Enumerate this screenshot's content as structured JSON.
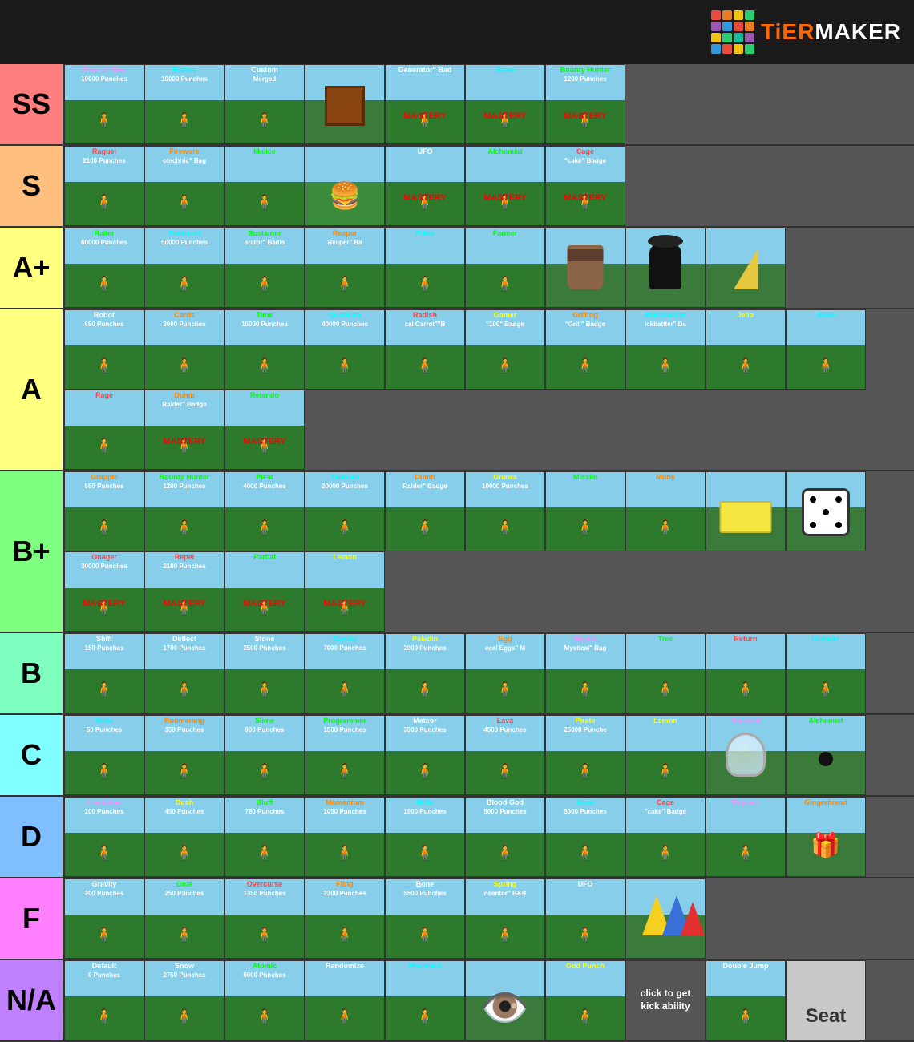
{
  "logo": {
    "text_part1": "TiER",
    "text_part2": "MAKER"
  },
  "tiers": [
    {
      "id": "ss",
      "label": "SS",
      "color": "#ff7f7f",
      "items": [
        {
          "name": "Giver of Sou",
          "sub": "10000 Punches",
          "name_color": "#ff88ff",
          "sub_color": "white",
          "type": "scene"
        },
        {
          "name": "Badius",
          "sub": "10000 Punches",
          "name_color": "#00ffff",
          "sub_color": "white",
          "type": "scene"
        },
        {
          "name": "Custom",
          "sub": "Merged",
          "name_color": "white",
          "sub_color": "white",
          "type": "scene"
        },
        {
          "name": "",
          "sub": "",
          "type": "brown_box"
        },
        {
          "name": "Generator\" Bad",
          "sub": "",
          "name_color": "white",
          "mastery": true,
          "type": "scene"
        },
        {
          "name": "Arow",
          "sub": "",
          "name_color": "#00ffff",
          "mastery": true,
          "type": "scene"
        },
        {
          "name": "Bounty Hunter",
          "sub": "1200 Punches",
          "name_color": "#00ff00",
          "sub_color": "white",
          "mastery": true,
          "type": "scene"
        }
      ]
    },
    {
      "id": "s",
      "label": "S",
      "color": "#ffbf7f",
      "items": [
        {
          "name": "Raguel",
          "sub": "2100 Punches",
          "name_color": "#ff4444",
          "sub_color": "white",
          "type": "scene"
        },
        {
          "name": "Firework",
          "sub": "otechnic\" Bag",
          "name_color": "#ff8800",
          "sub_color": "white",
          "type": "scene"
        },
        {
          "name": "Malice",
          "sub": "",
          "name_color": "#00ff00",
          "sub_color": "white",
          "type": "scene"
        },
        {
          "name": "",
          "sub": "",
          "type": "burger"
        },
        {
          "name": "UFO",
          "sub": "",
          "name_color": "white",
          "mastery": true,
          "type": "scene"
        },
        {
          "name": "Alchemist",
          "sub": "",
          "name_color": "#00ff00",
          "mastery": true,
          "type": "scene"
        },
        {
          "name": "Cage",
          "sub": "\"cake\" Badge",
          "name_color": "#ff4444",
          "mastery": true,
          "type": "scene"
        }
      ]
    },
    {
      "id": "ap",
      "label": "A+",
      "color": "#ffff7f",
      "items": [
        {
          "name": "Railer",
          "sub": "60000 Punches",
          "name_color": "#00ff00",
          "sub_color": "white",
          "type": "scene"
        },
        {
          "name": "Starburst",
          "sub": "50000 Punches",
          "name_color": "#00ffff",
          "sub_color": "white",
          "type": "scene"
        },
        {
          "name": "Sustainer",
          "sub": "erator\" Badis",
          "name_color": "#00ff00",
          "sub_color": "white",
          "type": "scene"
        },
        {
          "name": "Reaper",
          "sub": "Reaper\" Ba",
          "name_color": "#ff8800",
          "sub_color": "white",
          "type": "scene"
        },
        {
          "name": "Pulse",
          "sub": "",
          "name_color": "#00ffff",
          "sub_color": "white",
          "type": "scene"
        },
        {
          "name": "Farmer",
          "sub": "",
          "name_color": "#00ff00",
          "sub_color": "white",
          "type": "scene"
        },
        {
          "name": "",
          "sub": "",
          "type": "coffee"
        },
        {
          "name": "",
          "sub": "",
          "type": "cylinder"
        },
        {
          "name": "",
          "sub": "",
          "type": "wedge"
        }
      ]
    },
    {
      "id": "a",
      "label": "A",
      "color": "#ffff7f",
      "items": [
        {
          "name": "Robot",
          "sub": "650 Punches",
          "name_color": "white",
          "sub_color": "white",
          "type": "scene"
        },
        {
          "name": "Cards",
          "sub": "3000 Punches",
          "name_color": "#ff8800",
          "sub_color": "white",
          "type": "scene"
        },
        {
          "name": "Time",
          "sub": "15000 Punches",
          "name_color": "#00ff00",
          "sub_color": "white",
          "type": "scene"
        },
        {
          "name": "Quantum",
          "sub": "40000 Punches",
          "name_color": "#00ffff",
          "sub_color": "white",
          "type": "scene"
        },
        {
          "name": "Radish",
          "sub": "cal Carrot\"\"B",
          "name_color": "#ff4444",
          "sub_color": "white",
          "type": "scene"
        },
        {
          "name": "Gamer",
          "sub": "\"100\" Badge",
          "name_color": "#ffff00",
          "sub_color": "white",
          "type": "scene"
        },
        {
          "name": "Grilling",
          "sub": "\"Grill\" Badge",
          "name_color": "#ff8800",
          "sub_color": "white",
          "type": "scene"
        },
        {
          "name": "Brickbattler",
          "sub": "ickbattler\" Da",
          "name_color": "#00ffff",
          "sub_color": "white",
          "type": "scene"
        },
        {
          "name": "Jello",
          "sub": "",
          "name_color": "#ffff00",
          "sub_color": "white",
          "type": "scene"
        },
        {
          "name": "Arow",
          "sub": "",
          "name_color": "#00ffff",
          "sub_color": "white",
          "type": "scene"
        },
        {
          "name": "Rage",
          "sub": "",
          "name_color": "#ff4444",
          "sub_color": "white",
          "type": "scene"
        },
        {
          "name": "Dumb",
          "sub": "Raider\" Badge",
          "name_color": "#ff8800",
          "sub_color": "white",
          "mastery": true,
          "type": "scene"
        },
        {
          "name": "Retendo",
          "sub": "",
          "name_color": "#00ff00",
          "sub_color": "white",
          "mastery": true,
          "type": "scene"
        }
      ]
    },
    {
      "id": "bp",
      "label": "B+",
      "color": "#7fff7f",
      "items": [
        {
          "name": "Grapple",
          "sub": "550 Punches",
          "name_color": "#ff8800",
          "sub_color": "white",
          "type": "scene"
        },
        {
          "name": "Bounty Hunter",
          "sub": "1200 Punches",
          "name_color": "#00ff00",
          "sub_color": "white",
          "type": "scene"
        },
        {
          "name": "Pleat",
          "sub": "4000 Punches",
          "name_color": "#00ff00",
          "sub_color": "white",
          "type": "scene"
        },
        {
          "name": "Tantrum",
          "sub": "20000 Punches",
          "name_color": "#00ffff",
          "sub_color": "white",
          "type": "scene"
        },
        {
          "name": "Dumb",
          "sub": "Raider\" Badge",
          "name_color": "#ff8800",
          "sub_color": "white",
          "type": "scene"
        },
        {
          "name": "Gnawa",
          "sub": "10000 Punches",
          "name_color": "#ffff00",
          "sub_color": "white",
          "type": "scene"
        },
        {
          "name": "Missile",
          "sub": "",
          "name_color": "#00ff00",
          "sub_color": "white",
          "type": "scene"
        },
        {
          "name": "Monk",
          "sub": "",
          "name_color": "#ff8800",
          "sub_color": "white",
          "type": "scene"
        },
        {
          "name": "",
          "sub": "",
          "type": "butter"
        },
        {
          "name": "",
          "sub": "",
          "type": "die"
        },
        {
          "name": "Onager",
          "sub": "30000 Punches",
          "name_color": "#ff4444",
          "mastery": true,
          "type": "scene"
        },
        {
          "name": "Repel",
          "sub": "2100 Punches",
          "name_color": "#ff4444",
          "mastery": true,
          "type": "scene"
        },
        {
          "name": "Partial",
          "sub": "",
          "name_color": "#00ff00",
          "mastery": true,
          "type": "scene"
        },
        {
          "name": "Lemon",
          "sub": "",
          "name_color": "#ffff00",
          "mastery": true,
          "type": "scene"
        }
      ]
    },
    {
      "id": "b",
      "label": "B",
      "color": "#7fffbf",
      "items": [
        {
          "name": "Shift",
          "sub": "150 Punches",
          "name_color": "white",
          "sub_color": "white",
          "type": "scene"
        },
        {
          "name": "Deflect",
          "sub": "1700 Punches",
          "name_color": "white",
          "sub_color": "white",
          "type": "scene"
        },
        {
          "name": "Stone",
          "sub": "2500 Punches",
          "name_color": "white",
          "sub_color": "white",
          "type": "scene"
        },
        {
          "name": "Crystal",
          "sub": "7000 Punches",
          "name_color": "#00ffff",
          "sub_color": "white",
          "type": "scene"
        },
        {
          "name": "Paladin",
          "sub": "2000 Punches",
          "name_color": "#ffff00",
          "sub_color": "white",
          "type": "scene"
        },
        {
          "name": "Egg",
          "sub": "ecal Eggs\" M",
          "name_color": "#ff8800",
          "sub_color": "white",
          "type": "scene"
        },
        {
          "name": "Mystic",
          "sub": "Mystical\" Bag",
          "name_color": "#ff88ff",
          "sub_color": "white",
          "type": "scene"
        },
        {
          "name": "Tree",
          "sub": "",
          "name_color": "#00ff00",
          "sub_color": "white",
          "type": "scene"
        },
        {
          "name": "Return",
          "sub": "",
          "name_color": "#ff4444",
          "sub_color": "white",
          "type": "scene"
        },
        {
          "name": "Islonder",
          "sub": "",
          "name_color": "#00ffff",
          "sub_color": "white",
          "type": "scene"
        }
      ]
    },
    {
      "id": "c",
      "label": "C",
      "color": "#7fffff",
      "items": [
        {
          "name": "Soda",
          "sub": "50 Punches",
          "name_color": "#00ffff",
          "sub_color": "white",
          "type": "scene"
        },
        {
          "name": "Boomerang",
          "sub": "350 Punches",
          "name_color": "#ff8800",
          "sub_color": "white",
          "type": "scene"
        },
        {
          "name": "Slime",
          "sub": "900 Punches",
          "name_color": "#00ff00",
          "sub_color": "white",
          "type": "scene"
        },
        {
          "name": "Programmer",
          "sub": "1500 Punches",
          "name_color": "#00ff00",
          "sub_color": "white",
          "type": "scene"
        },
        {
          "name": "Meteor",
          "sub": "3500 Punches",
          "name_color": "white",
          "sub_color": "white",
          "type": "scene"
        },
        {
          "name": "Lava",
          "sub": "4500 Punches",
          "name_color": "#ff4444",
          "sub_color": "white",
          "type": "scene"
        },
        {
          "name": "Pirate",
          "sub": "25000 Punche",
          "name_color": "#ffff00",
          "sub_color": "white",
          "type": "scene"
        },
        {
          "name": "Lemon",
          "sub": "",
          "name_color": "#ffff00",
          "sub_color": "white",
          "type": "scene"
        },
        {
          "name": "Spectral",
          "sub": "",
          "name_color": "#ff88ff",
          "sub_color": "white",
          "type": "snow_globe"
        },
        {
          "name": "Alchemist",
          "sub": "",
          "name_color": "#00ff00",
          "sub_color": "white",
          "type": "black_dot_cell"
        }
      ]
    },
    {
      "id": "d",
      "label": "D",
      "color": "#7fbfff",
      "items": [
        {
          "name": "Levitation",
          "sub": "100 Punches",
          "name_color": "#ff88ff",
          "sub_color": "white",
          "type": "scene"
        },
        {
          "name": "Dush",
          "sub": "450 Punches",
          "name_color": "#ffff00",
          "sub_color": "white",
          "type": "scene"
        },
        {
          "name": "Bluff",
          "sub": "750 Punches",
          "name_color": "#00ff00",
          "sub_color": "white",
          "type": "scene"
        },
        {
          "name": "Momentum",
          "sub": "1050 Punches",
          "name_color": "#ff8800",
          "sub_color": "white",
          "type": "scene"
        },
        {
          "name": "Helix",
          "sub": "1900 Punches",
          "name_color": "#00ffff",
          "sub_color": "white",
          "type": "scene"
        },
        {
          "name": "Blood God",
          "sub": "5000 Punches",
          "name_color": "white",
          "sub_color": "white",
          "type": "scene"
        },
        {
          "name": "Arow",
          "sub": "5000 Punches",
          "name_color": "#00ffff",
          "sub_color": "white",
          "type": "scene"
        },
        {
          "name": "Cage",
          "sub": "\"cake\" Badge",
          "name_color": "#ff4444",
          "sub_color": "white",
          "type": "scene"
        },
        {
          "name": "Popcart",
          "sub": "",
          "name_color": "#ff88ff",
          "sub_color": "white",
          "type": "scene"
        },
        {
          "name": "Gingerbread",
          "sub": "",
          "name_color": "#ff8800",
          "sub_color": "white",
          "type": "gingerbread_cell"
        }
      ]
    },
    {
      "id": "f",
      "label": "F",
      "color": "#ff7fff",
      "items": [
        {
          "name": "Gravity",
          "sub": "200 Punches",
          "name_color": "white",
          "sub_color": "white",
          "type": "scene"
        },
        {
          "name": "Glue",
          "sub": "250 Punches",
          "name_color": "#00ff00",
          "sub_color": "white",
          "type": "scene"
        },
        {
          "name": "Overcurse",
          "sub": "1350 Punches",
          "name_color": "#ff4444",
          "sub_color": "white",
          "type": "scene"
        },
        {
          "name": "Fling",
          "sub": "2300 Punches",
          "name_color": "#ff8800",
          "sub_color": "white",
          "type": "scene"
        },
        {
          "name": "Bone",
          "sub": "5500 Punches",
          "name_color": "white",
          "sub_color": "white",
          "type": "scene"
        },
        {
          "name": "Spring",
          "sub": "neentor\" B&B",
          "name_color": "#ffff00",
          "sub_color": "white",
          "type": "scene"
        },
        {
          "name": "UFO",
          "sub": "",
          "name_color": "white",
          "sub_color": "white",
          "type": "scene"
        },
        {
          "name": "",
          "sub": "",
          "type": "cones"
        }
      ]
    },
    {
      "id": "na",
      "label": "N/A",
      "color": "#bf7fff",
      "items": [
        {
          "name": "Default",
          "sub": "0 Punches",
          "name_color": "white",
          "sub_color": "white",
          "type": "scene"
        },
        {
          "name": "Snow",
          "sub": "2750 Punches",
          "name_color": "white",
          "sub_color": "white",
          "type": "scene"
        },
        {
          "name": "Atomic",
          "sub": "6000 Punches",
          "name_color": "#00ff00",
          "sub_color": "white",
          "type": "scene"
        },
        {
          "name": "Randomize",
          "sub": "",
          "name_color": "white",
          "sub_color": "white",
          "type": "scene"
        },
        {
          "name": "Hivemind",
          "sub": "",
          "name_color": "#00ffff",
          "sub_color": "white",
          "type": "scene"
        },
        {
          "name": "",
          "sub": "",
          "type": "eye"
        },
        {
          "name": "God Punch",
          "sub": "",
          "name_color": "#ffff00",
          "sub_color": "white",
          "type": "scene"
        },
        {
          "name": "click to get kick ability",
          "sub": "",
          "type": "click_to_pet"
        },
        {
          "name": "Double Jump",
          "sub": "",
          "name_color": "white",
          "sub_color": "white",
          "type": "scene"
        },
        {
          "name": "Seat",
          "sub": "",
          "type": "seat"
        }
      ]
    }
  ]
}
